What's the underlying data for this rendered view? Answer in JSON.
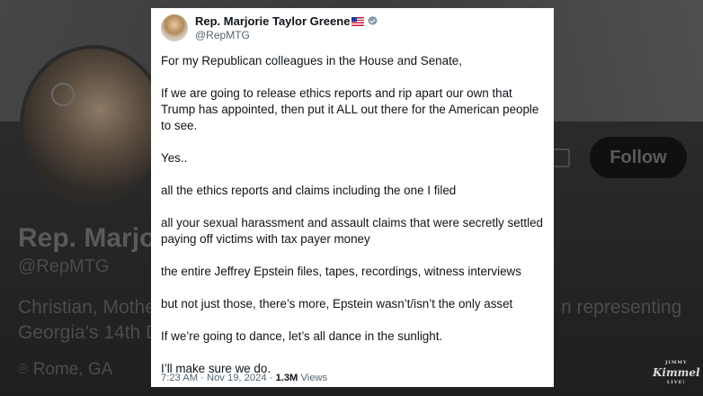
{
  "background": {
    "name": "Rep. Marjor",
    "handle": "@RepMTG",
    "bio_line1": "Christian, Mothe",
    "bio_line2": "Georgia’s 14th D",
    "bio_right": "n representing",
    "location": "Rome, GA",
    "follow_label": "Follow"
  },
  "tweet": {
    "author_name": "Rep. Marjorie Taylor Greene",
    "handle": "@RepMTG",
    "paragraphs": [
      "For my Republican colleagues in the House and Senate,",
      "If we are going to release ethics reports and rip apart our own that Trump has appointed, then put it ALL out there for the American people to see.",
      "Yes..",
      "all the ethics reports and claims including the one I filed",
      "all your sexual harassment and assault claims that were secretly settled paying off victims with tax payer money",
      "the entire Jeffrey Epstein files, tapes, recordings, witness interviews",
      "but not just those, there’s more, Epstein wasn’t/isn’t the only asset",
      "If we’re going to dance, let’s all dance in the sunlight.",
      "I’ll make sure we do."
    ],
    "timestamp": "7:23 AM · Nov 19, 2024 · ",
    "views_count": "1.3M",
    "views_label": " Views",
    "icons": [
      "us-flag-icon",
      "verified-badge-icon"
    ]
  },
  "watermark": {
    "top": "JIMMY",
    "main": "Kimmel",
    "bottom": "LIVE!"
  },
  "colors": {
    "text": "#0f1419",
    "secondary": "#536471",
    "verified_badge": "#829aab"
  }
}
